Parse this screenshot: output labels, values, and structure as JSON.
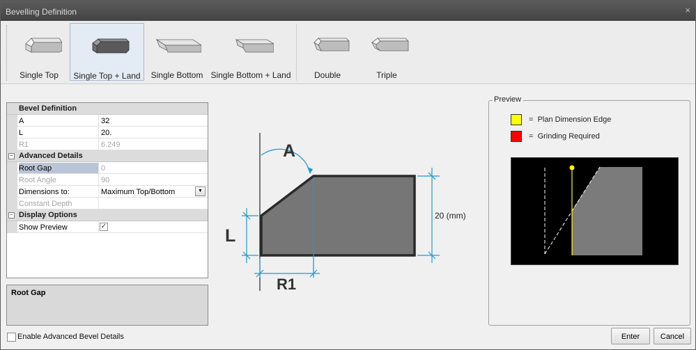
{
  "window": {
    "title": "Bevelling Definition",
    "close_glyph": "×"
  },
  "ribbon": {
    "buttons": [
      {
        "label": "Single Top",
        "icon": "single-top-bevel-icon",
        "selected": false
      },
      {
        "label": "Single Top + Land",
        "icon": "single-top-land-bevel-icon",
        "selected": true
      },
      {
        "label": "Single Bottom",
        "icon": "single-bottom-bevel-icon",
        "selected": false
      },
      {
        "label": "Single Bottom + Land",
        "icon": "single-bottom-land-bevel-icon",
        "selected": false
      },
      {
        "label": "Double",
        "icon": "double-bevel-icon",
        "selected": false
      },
      {
        "label": "Triple",
        "icon": "triple-bevel-icon",
        "selected": false
      }
    ]
  },
  "properties": {
    "bevel_definition": {
      "title": "Bevel Definition",
      "rows": [
        {
          "name": "A",
          "value": "32",
          "enabled": true
        },
        {
          "name": "L",
          "value": "20.",
          "enabled": true
        },
        {
          "name": "R1",
          "value": "6.249",
          "enabled": false
        }
      ]
    },
    "advanced_details": {
      "title": "Advanced Details",
      "toggle": "−",
      "rows": [
        {
          "name": "Root Gap",
          "value": "0",
          "enabled": false,
          "highlighted": true
        },
        {
          "name": "Root Angle",
          "value": "90",
          "enabled": false
        },
        {
          "name": "Dimensions to:",
          "value": "Maximum Top/Bottom",
          "enabled": true,
          "dropdown": true
        },
        {
          "name": "Constant Depth",
          "value": "",
          "enabled": false
        }
      ]
    },
    "display_options": {
      "title": "Display Options",
      "toggle": "−",
      "rows": [
        {
          "name": "Show Preview",
          "checked": true,
          "check_glyph": "✓"
        }
      ]
    }
  },
  "description": {
    "title": "Root Gap"
  },
  "enable_advanced": {
    "label": "Enable Advanced Bevel Details",
    "checked": false
  },
  "diagram": {
    "angle_label": "A",
    "land_label": "L",
    "r1_label": "R1",
    "thickness_label": "20 (mm)",
    "colors": {
      "plate_fill": "#7a7a7a",
      "plate_stroke": "#2a2a2a",
      "dimension": "#1f9ad6"
    }
  },
  "preview": {
    "title": "Preview",
    "legend": [
      {
        "color": "#ffff00",
        "label": "Plan Dimension Edge"
      },
      {
        "color": "#ff0000",
        "label": "Grinding Required"
      }
    ],
    "legend_prefix": "="
  },
  "buttons": {
    "enter": "Enter",
    "cancel": "Cancel"
  }
}
